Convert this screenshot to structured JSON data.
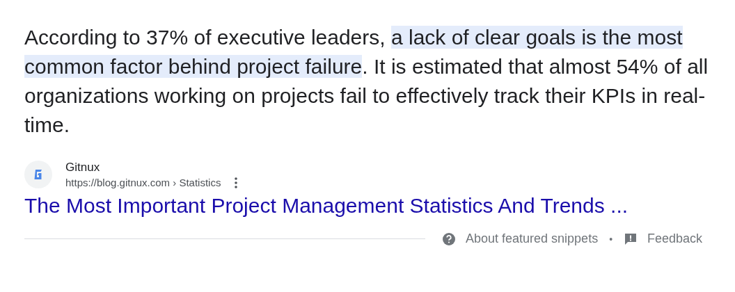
{
  "snippet": {
    "parts": [
      {
        "text": "According to 37% of executive leaders, ",
        "highlighted": false
      },
      {
        "text": "a lack of clear goals is the most common factor behind project failure",
        "highlighted": true
      },
      {
        "text": ". It is estimated that almost 54% of all organizations working on projects fail to effectively track their KPIs in real-time.",
        "highlighted": false
      }
    ]
  },
  "source": {
    "name": "Gitnux",
    "url": "https://blog.gitnux.com › Statistics",
    "title": "The Most Important Project Management Statistics And Trends ..."
  },
  "footer": {
    "about": "About featured snippets",
    "separator": "•",
    "feedback": "Feedback"
  }
}
